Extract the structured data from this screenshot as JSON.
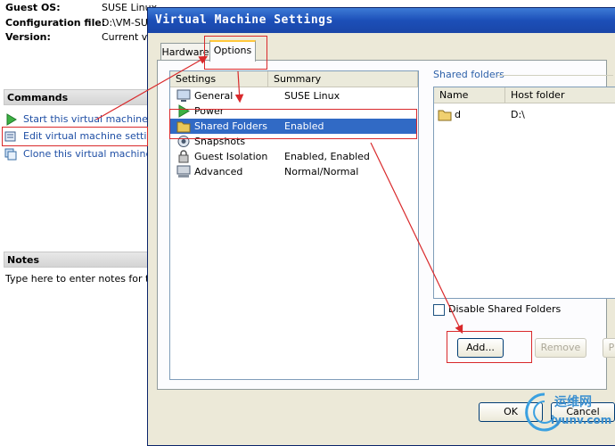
{
  "background": {
    "info": [
      {
        "key": "Guest OS:",
        "value": "SUSE Linux"
      },
      {
        "key": "Configuration file:",
        "value": "D:\\VM-SUS"
      },
      {
        "key": "Version:",
        "value": "Current vir"
      }
    ],
    "commands_title": "Commands",
    "commands": [
      {
        "label": "Start this virtual machine",
        "icon": "play-icon"
      },
      {
        "label": "Edit virtual machine settings",
        "icon": "edit-settings-icon"
      },
      {
        "label": "Clone this virtual machine",
        "icon": "clone-icon"
      }
    ],
    "notes_title": "Notes",
    "notes_text": "Type here to enter notes for this"
  },
  "dialog": {
    "title": "Virtual Machine Settings",
    "tabs": [
      "Hardware",
      "Options"
    ],
    "active_tab": "Options",
    "settings_columns": [
      "Settings",
      "Summary"
    ],
    "settings_rows": [
      {
        "setting": "General",
        "summary": "SUSE Linux",
        "icon": "monitor-icon"
      },
      {
        "setting": "Power",
        "summary": "",
        "icon": "power-play-icon"
      },
      {
        "setting": "Shared Folders",
        "summary": "Enabled",
        "icon": "folder-icon",
        "selected": true
      },
      {
        "setting": "Snapshots",
        "summary": "",
        "icon": "snapshot-icon"
      },
      {
        "setting": "Guest Isolation",
        "summary": "Enabled, Enabled",
        "icon": "lock-icon"
      },
      {
        "setting": "Advanced",
        "summary": "Normal/Normal",
        "icon": "computer-icon"
      }
    ],
    "shared_folders_label": "Shared folders",
    "shared_columns": [
      "Name",
      "Host folder"
    ],
    "shared_rows": [
      {
        "name": "d",
        "host": "D:\\"
      }
    ],
    "disable_label": "Disable Shared Folders",
    "disable_checked": false,
    "add_label": "Add...",
    "remove_label": "Remove",
    "properties_label": "P",
    "ok_label": "OK",
    "cancel_label": "Cancel"
  },
  "watermark": {
    "text1": "运维网",
    "text2": "iyunv.com"
  },
  "colors": {
    "annotation": "#d9292b",
    "selection": "#316ac5",
    "title_bar": "#1c4fb8",
    "link": "#1f4fa5"
  }
}
